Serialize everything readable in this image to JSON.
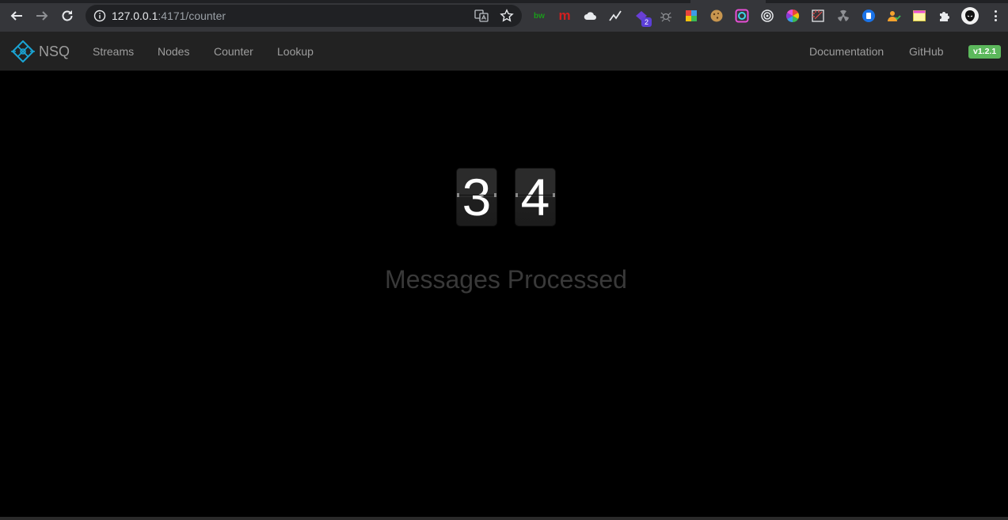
{
  "browser": {
    "url_host": "127.0.0.1",
    "url_rest": ":4171/counter",
    "extension_badge": "2",
    "extensions": [
      {
        "name": "bw-extension-icon",
        "text": "bw",
        "color": "#1a9b1a"
      },
      {
        "name": "m-extension-icon",
        "text": "m",
        "color": "#d21f1f"
      }
    ],
    "colors": {
      "chrome": "#35363a",
      "omnibox": "#202124"
    }
  },
  "navbar": {
    "brand": "NSQ",
    "links": [
      "Streams",
      "Nodes",
      "Counter",
      "Lookup"
    ],
    "right_links": [
      "Documentation",
      "GitHub"
    ],
    "version": "v1.2.1",
    "colors": {
      "background": "#222222",
      "link": "#9d9d9d",
      "badge": "#5cb85c",
      "logo": "#1aa4d4"
    }
  },
  "counter": {
    "digits": [
      "3",
      "4"
    ],
    "label": "Messages Processed"
  }
}
